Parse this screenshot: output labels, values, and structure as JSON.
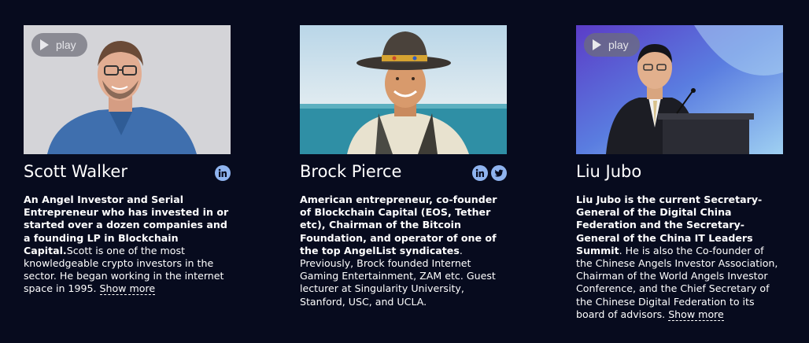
{
  "cards": [
    {
      "name": "Scott Walker",
      "play_label": "play",
      "socials": [
        "linkedin-icon"
      ],
      "bio_bold": "An Angel Investor and Serial Entrepreneur who has invested in or started over a dozen companies and a founding LP in Blockchain Capital.",
      "bio_regular": "Scott is one of the most knowledgeable crypto investors in the sector. He began working in the internet space in 1995. ",
      "show_more": "Show more"
    },
    {
      "name": "Brock Pierce",
      "play_label": "",
      "socials": [
        "linkedin-icon",
        "twitter-icon"
      ],
      "bio_bold": "American entrepreneur, co-founder of Blockchain Capital (EOS, Tether etc), Chairman of the Bitcoin Foundation, and operator of one of the top AngelList syndicates",
      "bio_regular": ". Previously, Brock founded Internet Gaming Entertainment, ZAM etc. Guest lecturer at Singularity University, Stanford, USC, and UCLA.",
      "show_more": ""
    },
    {
      "name": "Liu Jubo",
      "play_label": "play",
      "socials": [],
      "bio_bold": "Liu Jubo is the current Secretary-General of the Digital China Federation and the Secretary-General of the China IT Leaders Summit",
      "bio_regular": ". He is also the Co-founder of the Chinese Angels Investor Association, Chairman of the World Angels Investor Conference, and the Chief Secretary of the Chinese Digital Federation to its board of advisors. ",
      "show_more": "Show more"
    }
  ],
  "colors": {
    "background": "#070b1e",
    "social_icon": "#8fb4ef",
    "text": "#ffffff"
  }
}
